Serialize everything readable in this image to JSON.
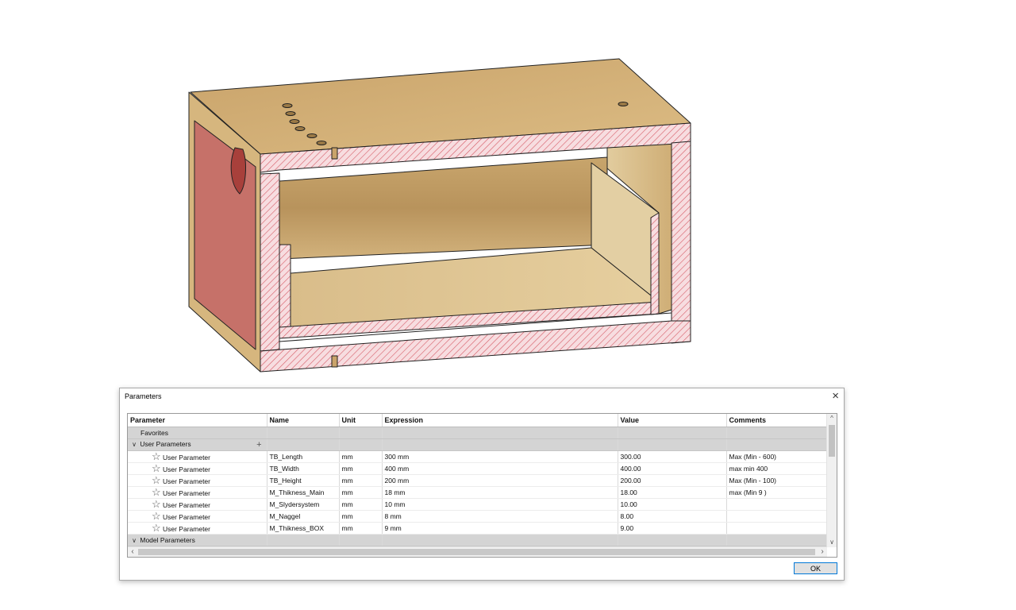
{
  "dialog": {
    "title": "Parameters",
    "close_glyph": "×",
    "ok_label": "OK"
  },
  "table": {
    "columns": [
      "Parameter",
      "Name",
      "Unit",
      "Expression",
      "Value",
      "Comments"
    ],
    "groups": {
      "favorites": "Favorites",
      "user": "User Parameters",
      "model": "Model Parameters"
    },
    "rows": [
      {
        "parameter": "User Parameter",
        "name": "TB_Length",
        "unit": "mm",
        "expression": "300 mm",
        "value": "300.00",
        "comments": "Max (Min - 600)"
      },
      {
        "parameter": "User Parameter",
        "name": "TB_Width",
        "unit": "mm",
        "expression": "400 mm",
        "value": "400.00",
        "comments": "max min 400"
      },
      {
        "parameter": "User Parameter",
        "name": "TB_Height",
        "unit": "mm",
        "expression": "200 mm",
        "value": "200.00",
        "comments": "Max (Min - 100)"
      },
      {
        "parameter": "User Parameter",
        "name": "M_Thikness_Main",
        "unit": "mm",
        "expression": "18 mm",
        "value": "18.00",
        "comments": "max (Min 9 )"
      },
      {
        "parameter": "User Parameter",
        "name": "M_Slydersystem",
        "unit": "mm",
        "expression": "10 mm",
        "value": "10.00",
        "comments": ""
      },
      {
        "parameter": "User Parameter",
        "name": "M_Naggel",
        "unit": "mm",
        "expression": "8 mm",
        "value": "8.00",
        "comments": ""
      },
      {
        "parameter": "User Parameter",
        "name": "M_Thikness_BOX",
        "unit": "mm",
        "expression": "9 mm",
        "value": "9.00",
        "comments": ""
      }
    ]
  },
  "icons": {
    "star": "star-outline-icon",
    "expand": "chevron-down-icon",
    "add": "plus-icon",
    "close": "close-icon"
  },
  "colors": {
    "wood": "#d8b57a",
    "section_fill": "#f6d9dc",
    "section_hatch": "#d8505c",
    "cut_face": "#c86e6e",
    "accent": "#0078d7"
  }
}
